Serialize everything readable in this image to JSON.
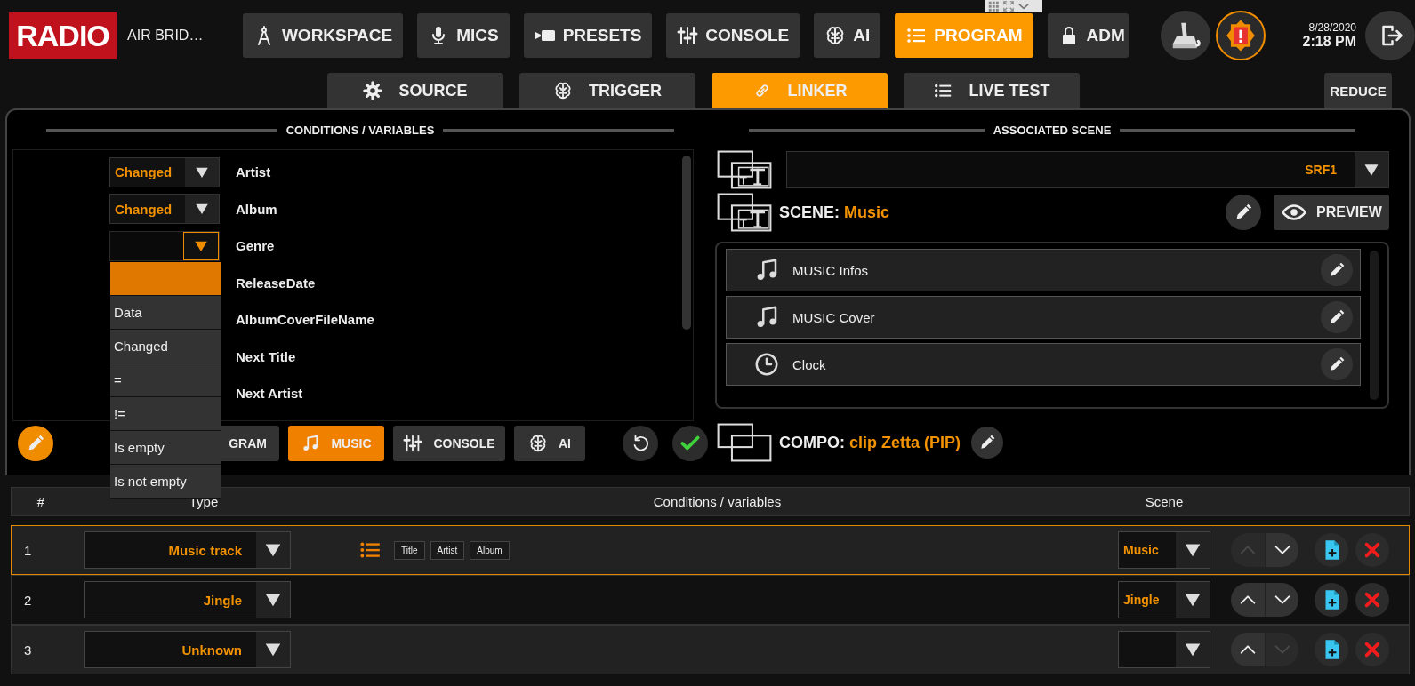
{
  "app": {
    "logo": "RADIO",
    "station": "AIR BRID…"
  },
  "nav": [
    {
      "label": "WORKSPACE",
      "selected": false
    },
    {
      "label": "MICS",
      "selected": false
    },
    {
      "label": "PRESETS",
      "selected": false
    },
    {
      "label": "CONSOLE",
      "selected": false
    },
    {
      "label": "AI",
      "selected": false
    },
    {
      "label": "PROGRAM",
      "selected": true
    },
    {
      "label": "ADM",
      "selected": false
    }
  ],
  "status": {
    "date": "8/28/2020",
    "time": "2:18 PM"
  },
  "tabs": [
    {
      "label": "SOURCE",
      "selected": false
    },
    {
      "label": "TRIGGER",
      "selected": false
    },
    {
      "label": "LINKER",
      "selected": true
    },
    {
      "label": "LIVE TEST",
      "selected": false
    }
  ],
  "reduce_button": "REDUCE",
  "conditions": {
    "title": "CONDITIONS / VARIABLES",
    "rows": [
      {
        "operator": "Changed",
        "name": "Artist",
        "open": false
      },
      {
        "operator": "Changed",
        "name": "Album",
        "open": false
      },
      {
        "name": "Genre",
        "open": true
      },
      {
        "name": "ReleaseDate"
      },
      {
        "name": "AlbumCoverFileName"
      },
      {
        "name": "Next Title"
      },
      {
        "name": "Next Artist"
      }
    ],
    "menu_options": [
      {
        "selected": true
      },
      {
        "label": "Data",
        "selected": false
      },
      {
        "label": "Changed",
        "selected": false
      },
      {
        "label": "=",
        "selected": false
      },
      {
        "label": "!=",
        "selected": false
      },
      {
        "label": "Is empty",
        "selected": false
      },
      {
        "label": "Is not empty",
        "selected": false
      }
    ],
    "categories": [
      {
        "label": "GRAM",
        "selected": false
      },
      {
        "label": "MUSIC",
        "selected": true
      },
      {
        "label": "CONSOLE",
        "selected": false
      },
      {
        "label": "AI",
        "selected": false
      }
    ]
  },
  "scene": {
    "title": "ASSOCIATED SCENE",
    "source": "SRF1",
    "scene_label": "SCENE:",
    "scene_name": "Music",
    "preview_button": "PREVIEW",
    "elements": [
      {
        "kind": "music",
        "label": "MUSIC Infos"
      },
      {
        "kind": "music",
        "label": "MUSIC Cover"
      },
      {
        "kind": "clock",
        "label": "Clock"
      }
    ],
    "compo_label": "COMPO:",
    "compo_name": "clip Zetta (PIP)"
  },
  "table": {
    "columns": [
      "#",
      "Type",
      "Conditions / variables",
      "Scene"
    ],
    "rows": [
      {
        "number": "1",
        "type": "Music track",
        "conditions": [
          "Title",
          "Artist",
          "Album"
        ],
        "scene": "Music",
        "selected": true,
        "up_disabled": true,
        "down_disabled": false
      },
      {
        "number": "2",
        "type": "Jingle",
        "scene": "Jingle",
        "selected": false,
        "up_disabled": false,
        "down_disabled": false
      },
      {
        "number": "3",
        "type": "Unknown",
        "selected": false,
        "up_disabled": false,
        "down_disabled": true
      }
    ]
  }
}
